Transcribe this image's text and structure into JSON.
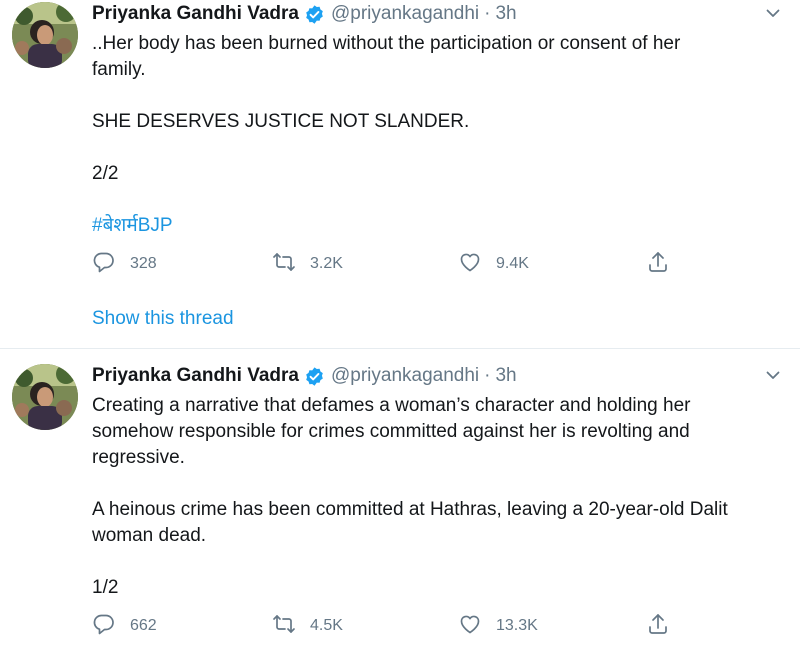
{
  "tweets": [
    {
      "name": "Priyanka Gandhi Vadra",
      "handle": "@priyankagandhi",
      "separator": "·",
      "time": "3h",
      "lines": [
        "..Her body has been burned without the participation or consent of her",
        "family.",
        "",
        "SHE DESERVES JUSTICE NOT SLANDER.",
        "",
        "2/2",
        ""
      ],
      "hashtag": "#बेशर्मBJP",
      "replies": "328",
      "retweets": "3.2K",
      "likes": "9.4K",
      "show_thread": "Show this thread"
    },
    {
      "name": "Priyanka Gandhi Vadra",
      "handle": "@priyankagandhi",
      "separator": "·",
      "time": "3h",
      "lines": [
        "Creating a narrative that defames a woman’s character and holding her",
        "somehow responsible for crimes committed against her is revolting and",
        "regressive.",
        "",
        "A heinous crime has been committed at Hathras, leaving a 20-year-old Dalit",
        "woman dead.",
        "",
        "1/2"
      ],
      "replies": "662",
      "retweets": "4.5K",
      "likes": "13.3K"
    }
  ],
  "icons": {
    "verified": "verified-badge-icon",
    "caret": "chevron-down-icon",
    "reply": "reply-icon",
    "retweet": "retweet-icon",
    "like": "heart-icon",
    "share": "share-icon"
  },
  "colors": {
    "text": "#14171a",
    "secondary": "#657786",
    "link": "#1b95e0",
    "verified": "#1da1f2",
    "divider": "#e6ecf0"
  }
}
